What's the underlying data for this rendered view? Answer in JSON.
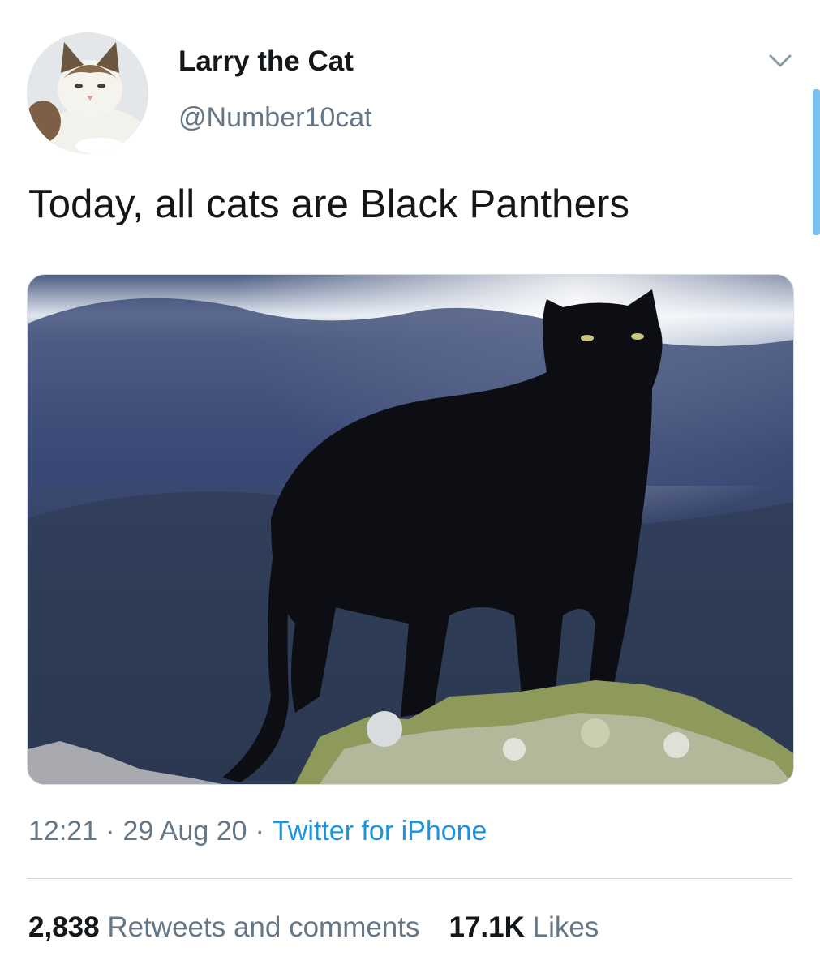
{
  "tweet": {
    "author": {
      "display_name": "Larry the Cat",
      "handle": "@Number10cat",
      "avatar_icon": "cat-avatar"
    },
    "text": "Today, all cats are Black Panthers",
    "media": {
      "description_icon": "black-panther-photo"
    },
    "time": "12:21",
    "date": "29 Aug 20",
    "source": "Twitter for iPhone",
    "separator": "·",
    "stats": {
      "retweets_count": "2,838",
      "retweets_label": "Retweets and comments",
      "likes_count": "17.1K",
      "likes_label": "Likes"
    }
  },
  "colors": {
    "text_primary": "#14171a",
    "text_secondary": "#657786",
    "link": "#1b95e0",
    "scroll_indicator": "#7cc0ef",
    "divider": "#d6dadd"
  },
  "icons": {
    "more_menu": "chevron-down-icon"
  }
}
